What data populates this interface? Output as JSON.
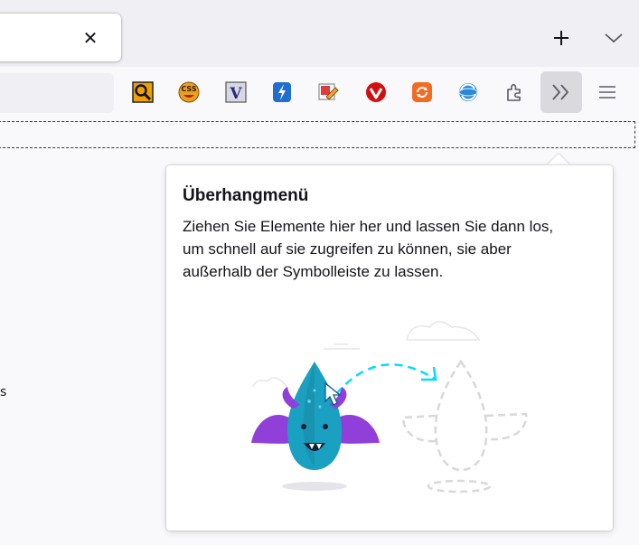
{
  "toolbar": {
    "tab_close_glyph": "✕",
    "new_tab_icon": "plus-icon",
    "tab_list_icon": "chevron-down-icon",
    "extensions": [
      {
        "name": "search-extension-icon",
        "color": "#f0a000"
      },
      {
        "name": "css-extension-icon",
        "color": "#e8a020"
      },
      {
        "name": "v-extension-icon",
        "color": "#c8c8d8"
      },
      {
        "name": "lightning-extension-icon",
        "color": "#1e6fd0"
      },
      {
        "name": "edit-extension-icon",
        "color": "#e03a3a"
      },
      {
        "name": "vivaldi-extension-icon",
        "color": "#d01010"
      },
      {
        "name": "refresh-extension-icon",
        "color": "#f26b21"
      },
      {
        "name": "sync-extension-icon",
        "color": "#2a88d8"
      }
    ],
    "extensions_menu_icon": "puzzle-icon",
    "overflow_icon": "double-chevron-right-icon",
    "app_menu_icon": "hamburger-menu-icon"
  },
  "page": {
    "edge_text": "s"
  },
  "overflow_panel": {
    "title": "Überhangmenü",
    "description_lines": [
      "Ziehen Sie Elemente hier her und lassen Sie dann los,",
      "um schnell auf sie zugreifen zu können, sie aber",
      "außerhalb der Symbolleiste zu lassen."
    ],
    "illustration": "dragon-drag-illustration"
  },
  "colors": {
    "accent": "#00ddff",
    "dragon_body": "#1aa0c0",
    "dragon_wings": "#9040d8"
  }
}
